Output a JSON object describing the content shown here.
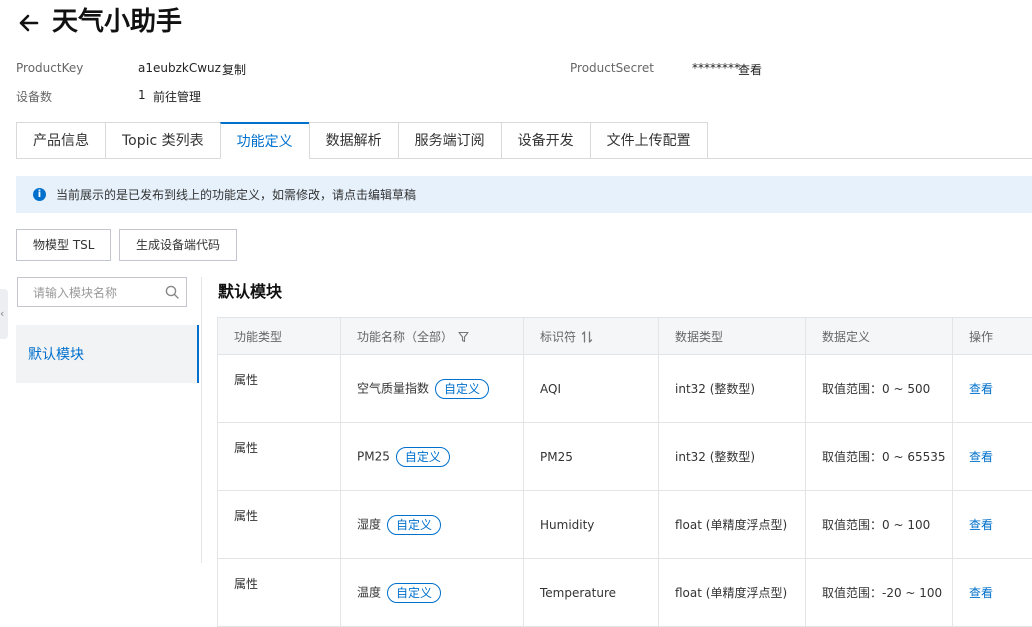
{
  "header": {
    "title": "天气小助手"
  },
  "meta": {
    "product_key_label": "ProductKey",
    "product_key_value": "a1eubzkCwuz",
    "copy_label": "复制",
    "device_count_label": "设备数",
    "device_count_value": "1",
    "manage_link": "前往管理",
    "product_secret_label": "ProductSecret",
    "product_secret_value": "********",
    "view_label": "查看"
  },
  "tabs": [
    {
      "label": "产品信息"
    },
    {
      "label": "Topic 类列表"
    },
    {
      "label": "功能定义",
      "active": true
    },
    {
      "label": "数据解析"
    },
    {
      "label": "服务端订阅"
    },
    {
      "label": "设备开发"
    },
    {
      "label": "文件上传配置"
    }
  ],
  "notice": {
    "text": "当前展示的是已发布到线上的功能定义，如需修改，请点击",
    "link": "编辑草稿"
  },
  "actions": {
    "tsl_button": "物模型 TSL",
    "generate_code_button": "生成设备端代码"
  },
  "sidebar": {
    "search_placeholder": "请输入模块名称",
    "module": "默认模块"
  },
  "main": {
    "section_title": "默认模块"
  },
  "table": {
    "headers": [
      "功能类型",
      "功能名称（全部）",
      "标识符",
      "数据类型",
      "数据定义",
      "操作"
    ],
    "tag_label": "自定义",
    "rows": [
      {
        "type": "属性",
        "name": "空气质量指数",
        "id": "AQI",
        "dtype": "int32 (整数型)",
        "def": "取值范围：0 ~ 500",
        "action": "查看"
      },
      {
        "type": "属性",
        "name": "PM25",
        "id": "PM25",
        "dtype": "int32 (整数型)",
        "def": "取值范围：0 ~ 65535",
        "action": "查看"
      },
      {
        "type": "属性",
        "name": "湿度",
        "id": "Humidity",
        "dtype": "float (单精度浮点型)",
        "def": "取值范围：0 ~ 100",
        "action": "查看"
      },
      {
        "type": "属性",
        "name": "温度",
        "id": "Temperature",
        "dtype": "float (单精度浮点型)",
        "def": "取值范围：-20 ~ 100",
        "action": "查看"
      }
    ]
  },
  "colors": {
    "accent": "#0070cc",
    "notice_bg": "#e6f1fb",
    "header_bg": "#f5f6f7"
  }
}
